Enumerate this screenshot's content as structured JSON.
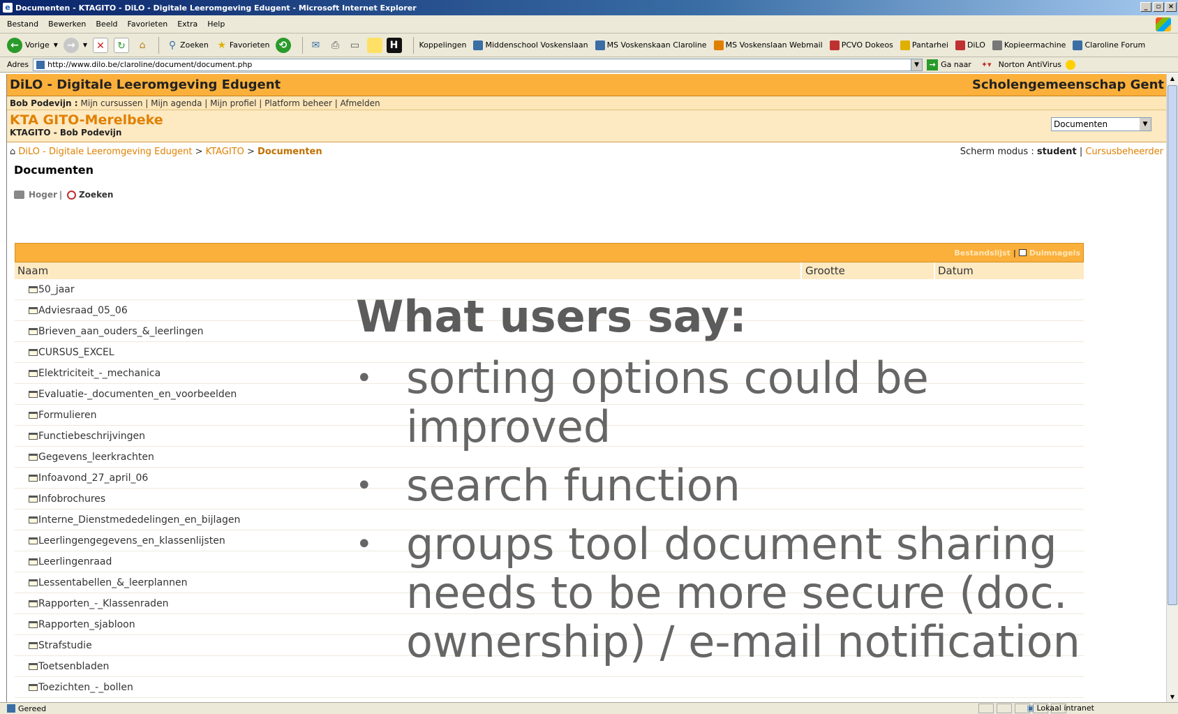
{
  "window": {
    "title": "Documenten - KTAGITO - DiLO - Digitale Leeromgeving Edugent - Microsoft Internet Explorer"
  },
  "menu": [
    "Bestand",
    "Bewerken",
    "Beeld",
    "Favorieten",
    "Extra",
    "Help"
  ],
  "toolbar": {
    "back": "Vorige",
    "search": "Zoeken",
    "favorites": "Favorieten",
    "links_label": "Koppelingen",
    "links": [
      "Middenschool Voskenslaan",
      "MS Voskenskaan Claroline",
      "MS Voskenslaan Webmail",
      "PCVO Dokeos",
      "Pantarhei",
      "DiLO",
      "Kopieermachine",
      "Claroline Forum"
    ]
  },
  "address": {
    "label": "Adres",
    "url": "http://www.dilo.be/claroline/document/document.php",
    "go": "Ga naar",
    "antivirus": "Norton AntiVirus"
  },
  "site": {
    "name": "DiLO - Digitale Leeromgeving Edugent",
    "org": "Scholengemeenschap Gent",
    "user": "Bob Podevijn :",
    "user_links": "Mijn cursussen | Mijn agenda | Mijn profiel | Platform beheer | Afmelden",
    "course_title": "KTA GITO-Merelbeke",
    "course_sub": "KTAGITO - Bob Podevijn",
    "tool_select": "Documenten"
  },
  "breadcrumb": {
    "home": "DiLO - Digitale Leeromgeving Edugent",
    "course": "KTAGITO",
    "current": "Documenten",
    "sep": ">"
  },
  "view_mode": {
    "label": "Scherm modus :",
    "student": "student",
    "sep": "|",
    "admin": "Cursusbeheerder"
  },
  "documents": {
    "title": "Documenten",
    "up": "Hoger",
    "sep": "|",
    "search": "Zoeken",
    "list_view": "Bestandslijst",
    "thumbs": "Duimnagels",
    "columns": [
      "Naam",
      "Grootte",
      "Datum"
    ],
    "folders": [
      "50_jaar",
      "Adviesraad_05_06",
      "Brieven_aan_ouders_&_leerlingen",
      "CURSUS_EXCEL",
      "Elektriciteit_-_mechanica",
      "Evaluatie-_documenten_en_voorbeelden",
      "Formulieren",
      "Functiebeschrijvingen",
      "Gegevens_leerkrachten",
      "Infoavond_27_april_06",
      "Infobrochures",
      "Interne_Dienstmededelingen_en_bijlagen",
      "Leerlingengegevens_en_klassenlijsten",
      "Leerlingenraad",
      "Lessentabellen_&_leerplannen",
      "Rapporten_-_Klassenraden",
      "Rapporten_sjabloon",
      "Strafstudie",
      "Toetsenbladen",
      "Toezichten_-_bollen"
    ]
  },
  "overlay": {
    "title": "What users say:",
    "bullets": [
      "sorting options could be improved",
      "search function",
      "groups tool document sharing needs to be more secure (doc. ownership) / e-mail notification"
    ]
  },
  "status": {
    "text": "Gereed",
    "zone": "Lokaal intranet"
  },
  "colors": {
    "header_orange": "#fbb03b",
    "link_orange": "#e08000",
    "overlay_text": "#666666"
  }
}
